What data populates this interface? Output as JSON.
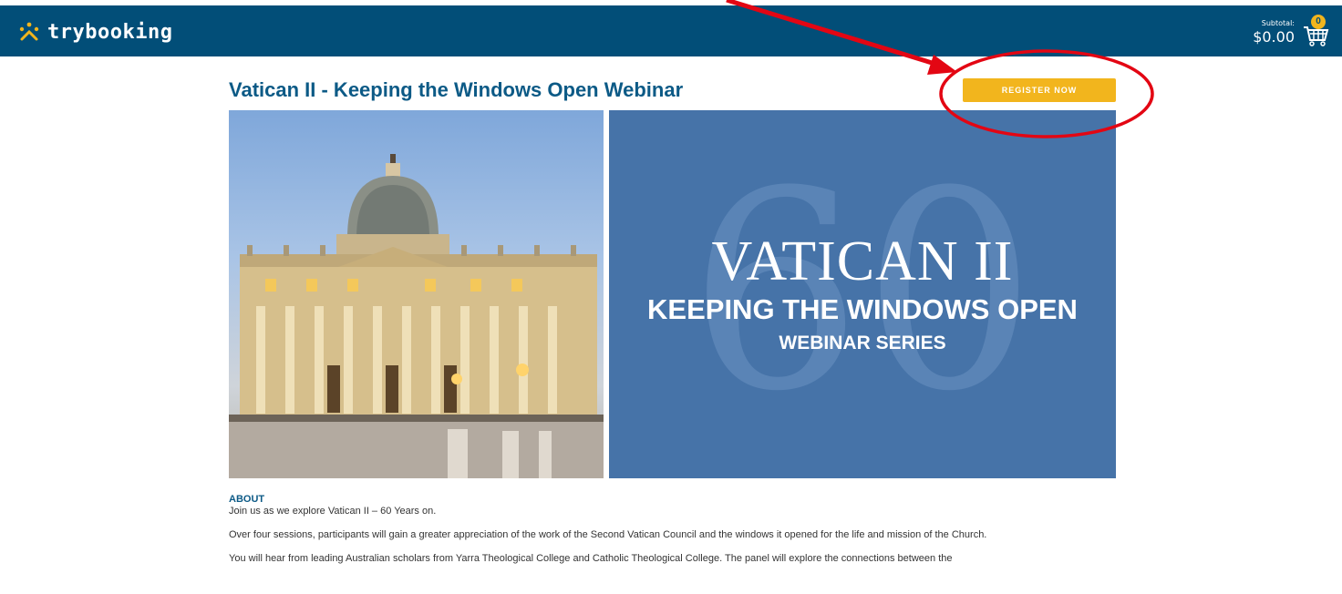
{
  "header": {
    "logo_text": "trybooking",
    "subtotal_label": "Subtotal:",
    "subtotal_value": "$0.00",
    "cart_count": "0"
  },
  "event": {
    "title": "Vatican II - Keeping the Windows Open Webinar",
    "register_label": "REGISTER NOW"
  },
  "banner": {
    "big_number": "60",
    "title": "VATICAN II",
    "subtitle": "KEEPING THE WINDOWS OPEN",
    "series": "WEBINAR SERIES"
  },
  "about": {
    "heading": "ABOUT",
    "paragraphs": [
      "Join us as we explore Vatican II – 60 Years on.",
      "Over four sessions, participants will gain a greater appreciation of the work of the Second Vatican Council and the windows it opened for the life and mission of the Church.",
      "You will hear from leading Australian scholars from Yarra Theological College and Catholic Theological College. The panel will explore the connections between the"
    ]
  },
  "colors": {
    "header_bg": "#024e78",
    "accent_yellow": "#f2b51d",
    "title_blue": "#0c5a86",
    "banner_blue": "#4673a8",
    "annotation_red": "#e30613"
  }
}
